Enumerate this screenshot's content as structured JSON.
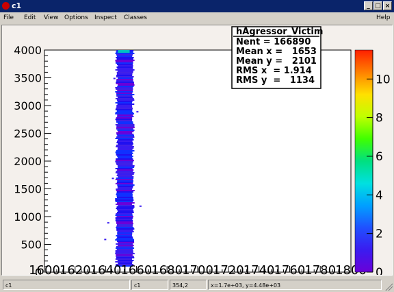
{
  "window": {
    "title": "c1"
  },
  "menu": {
    "file": "File",
    "edit": "Edit",
    "view": "View",
    "options": "Options",
    "inspect": "Inspect",
    "classes": "Classes",
    "help": "Help"
  },
  "stats": {
    "name": "hAgressor_Victim",
    "lines": [
      "Nent = 166890",
      "Mean x =   1653",
      "Mean y =   2101",
      "RMS x  = 1.914",
      "RMS y  =   1134"
    ]
  },
  "status": {
    "field1": "c1",
    "field2": "c1",
    "field3": "354,2",
    "field4": "x=1.7e+03, y=4.48e+03"
  },
  "colors": {
    "titlebar": "#0a246a",
    "plot_bg": "#ffffff",
    "canvas_bg": "#f4f0ec"
  },
  "chart_data": {
    "type": "heatmap",
    "xlim": [
      1600,
      1800
    ],
    "ylim": [
      0,
      4000
    ],
    "zlim": [
      0,
      11.5
    ],
    "x_ticks": [
      "1600",
      "1620",
      "1640",
      "1660",
      "1680",
      "1700",
      "1720",
      "1740",
      "1760",
      "1780",
      "1800"
    ],
    "y_ticks": [
      "0",
      "500",
      "1000",
      "1500",
      "2000",
      "2500",
      "3000",
      "3500",
      "4000"
    ],
    "z_ticks": [
      "0",
      "2",
      "4",
      "6",
      "8",
      "10"
    ],
    "band": {
      "x_min": 1647,
      "x_max": 1658,
      "y_min": 100,
      "y_max": 4000
    },
    "palette": [
      "#6a00d8",
      "#3a1cf0",
      "#2050ff",
      "#00a0ff",
      "#00e0e0",
      "#00e080",
      "#40ff00",
      "#c0ff00",
      "#ffe000",
      "#ff8000",
      "#ff2000"
    ]
  }
}
